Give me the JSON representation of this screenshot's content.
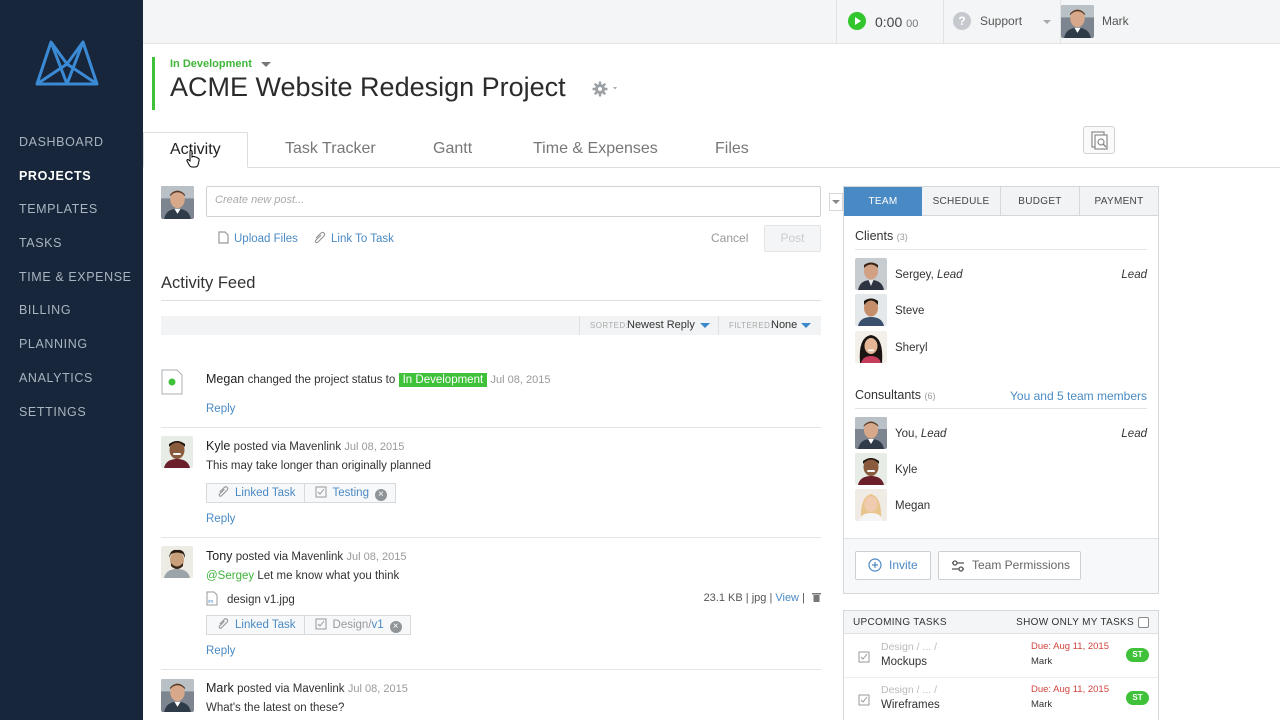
{
  "sidebar": {
    "items": [
      {
        "label": "DASHBOARD"
      },
      {
        "label": "PROJECTS"
      },
      {
        "label": "TEMPLATES"
      },
      {
        "label": "TASKS"
      },
      {
        "label": "TIME & EXPENSE"
      },
      {
        "label": "BILLING"
      },
      {
        "label": "PLANNING"
      },
      {
        "label": "ANALYTICS"
      },
      {
        "label": "SETTINGS"
      }
    ],
    "active": "PROJECTS"
  },
  "topbar": {
    "timer_main": "0:00",
    "timer_sec": "00",
    "support_label": "Support",
    "help_glyph": "?",
    "user_name": "Mark"
  },
  "project": {
    "status": "In Development",
    "title": "ACME Website Redesign Project"
  },
  "tabs": [
    {
      "label": "Activity"
    },
    {
      "label": "Task Tracker"
    },
    {
      "label": "Gantt"
    },
    {
      "label": "Time & Expenses"
    },
    {
      "label": "Files"
    }
  ],
  "composer": {
    "placeholder": "Create new post...",
    "upload_label": "Upload Files",
    "link_label": "Link To Task",
    "cancel_label": "Cancel",
    "post_label": "Post"
  },
  "feed": {
    "title": "Activity Feed",
    "sorted_label": "SORTED:",
    "sorted_value": "Newest Reply",
    "filtered_label": "FILTERED:",
    "filtered_value": "None",
    "reply_label": "Reply",
    "items": [
      {
        "name": "Megan",
        "action": "changed the project status to",
        "status": "In Development",
        "date": "Jul 08, 2015"
      },
      {
        "name": "Kyle",
        "action": "posted via Mavenlink",
        "date": "Jul 08, 2015",
        "body": "This may take longer than originally planned",
        "linked_label": "Linked Task",
        "task": "Testing"
      },
      {
        "name": "Tony",
        "action": "posted via Mavenlink",
        "date": "Jul 08, 2015",
        "mention": "@Sergey",
        "body": "Let me know what you think",
        "file_name": "design v1.jpg",
        "file_size": "23.1 KB",
        "file_sep1": "|",
        "file_type": "jpg",
        "file_sep2": "|",
        "view_label": "View",
        "file_sep3": "|",
        "linked_label": "Linked Task",
        "task_prefix": "Design",
        "task_slash": "/",
        "task": "v1"
      },
      {
        "name": "Mark",
        "action": "posted via Mavenlink",
        "date": "Jul 08, 2015",
        "body": "What's the latest on these?"
      }
    ]
  },
  "team_panel": {
    "tabs": [
      "TEAM",
      "SCHEDULE",
      "BUDGET",
      "PAYMENT"
    ],
    "clients_label": "Clients",
    "clients_count": "(3)",
    "clients": [
      {
        "name": "Sergey,",
        "name_role": "Lead",
        "role": "Lead"
      },
      {
        "name": "Steve"
      },
      {
        "name": "Sheryl"
      }
    ],
    "consultants_label": "Consultants",
    "consultants_count": "(6)",
    "team_link": "You and 5 team members",
    "consultants": [
      {
        "name": "You,",
        "name_role": "Lead",
        "role": "Lead"
      },
      {
        "name": "Kyle"
      },
      {
        "name": "Megan"
      }
    ],
    "invite_label": "Invite",
    "permissions_label": "Team Permissions"
  },
  "upcoming": {
    "title": "UPCOMING TASKS",
    "only_mine_label": "SHOW ONLY MY TASKS",
    "tasks": [
      {
        "path": "Design / ... /",
        "name": "Mockups",
        "due": "Due: Aug 11, 2015",
        "assignee": "Mark",
        "badge": "ST"
      },
      {
        "path": "Design / ... /",
        "name": "Wireframes",
        "due": "Due: Aug 11, 2015",
        "assignee": "Mark",
        "badge": "ST"
      }
    ]
  },
  "colors": {
    "sidebar_bg": "#17263a",
    "accent_blue": "#4a8ac4",
    "status_green": "#3fc23a",
    "due_red": "#d0443e"
  }
}
